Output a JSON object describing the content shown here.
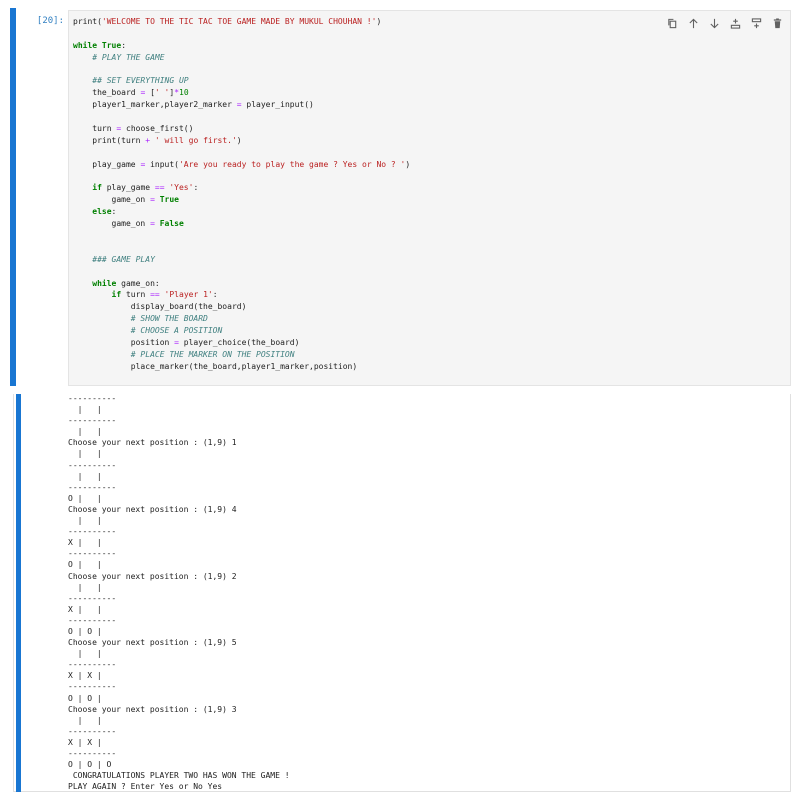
{
  "cell": {
    "prompt": "[20]:",
    "toolbar": [
      {
        "name": "duplicate-icon"
      },
      {
        "name": "move-up-icon"
      },
      {
        "name": "move-down-icon"
      },
      {
        "name": "insert-below-icon"
      },
      {
        "name": "insert-above-icon"
      },
      {
        "name": "delete-icon"
      }
    ],
    "code_lines": [
      [
        {
          "t": "print(",
          "c": ""
        },
        {
          "t": "'WELCOME TO THE TIC TAC TOE GAME MADE BY MUKUL CHOUHAN !'",
          "c": "str"
        },
        {
          "t": ")",
          "c": ""
        }
      ],
      [
        {
          "t": "",
          "c": ""
        }
      ],
      [
        {
          "t": "while",
          "c": "kw"
        },
        {
          "t": " ",
          "c": ""
        },
        {
          "t": "True",
          "c": "kw"
        },
        {
          "t": ":",
          "c": ""
        }
      ],
      [
        {
          "t": "    ",
          "c": ""
        },
        {
          "t": "# PLAY THE GAME",
          "c": "cm"
        }
      ],
      [
        {
          "t": "",
          "c": ""
        }
      ],
      [
        {
          "t": "    ",
          "c": ""
        },
        {
          "t": "## SET EVERYTHING UP",
          "c": "cm"
        }
      ],
      [
        {
          "t": "    the_board ",
          "c": ""
        },
        {
          "t": "=",
          "c": "op"
        },
        {
          "t": " [",
          "c": ""
        },
        {
          "t": "' '",
          "c": "str"
        },
        {
          "t": "]",
          "c": ""
        },
        {
          "t": "*",
          "c": "op"
        },
        {
          "t": "10",
          "c": "num"
        }
      ],
      [
        {
          "t": "    player1_marker,player2_marker ",
          "c": ""
        },
        {
          "t": "=",
          "c": "op"
        },
        {
          "t": " player_input()",
          "c": ""
        }
      ],
      [
        {
          "t": "",
          "c": ""
        }
      ],
      [
        {
          "t": "    turn ",
          "c": ""
        },
        {
          "t": "=",
          "c": "op"
        },
        {
          "t": " choose_first()",
          "c": ""
        }
      ],
      [
        {
          "t": "    print(turn ",
          "c": ""
        },
        {
          "t": "+",
          "c": "op"
        },
        {
          "t": " ",
          "c": ""
        },
        {
          "t": "' will go first.'",
          "c": "str"
        },
        {
          "t": ")",
          "c": ""
        }
      ],
      [
        {
          "t": "",
          "c": ""
        }
      ],
      [
        {
          "t": "    play_game ",
          "c": ""
        },
        {
          "t": "=",
          "c": "op"
        },
        {
          "t": " input(",
          "c": ""
        },
        {
          "t": "'Are you ready to play the game ? Yes or No ? '",
          "c": "str"
        },
        {
          "t": ")",
          "c": ""
        }
      ],
      [
        {
          "t": "",
          "c": ""
        }
      ],
      [
        {
          "t": "    ",
          "c": ""
        },
        {
          "t": "if",
          "c": "kw"
        },
        {
          "t": " play_game ",
          "c": ""
        },
        {
          "t": "==",
          "c": "op"
        },
        {
          "t": " ",
          "c": ""
        },
        {
          "t": "'Yes'",
          "c": "str"
        },
        {
          "t": ":",
          "c": ""
        }
      ],
      [
        {
          "t": "        game_on ",
          "c": ""
        },
        {
          "t": "=",
          "c": "op"
        },
        {
          "t": " ",
          "c": ""
        },
        {
          "t": "True",
          "c": "kw"
        }
      ],
      [
        {
          "t": "    ",
          "c": ""
        },
        {
          "t": "else",
          "c": "kw"
        },
        {
          "t": ":",
          "c": ""
        }
      ],
      [
        {
          "t": "        game_on ",
          "c": ""
        },
        {
          "t": "=",
          "c": "op"
        },
        {
          "t": " ",
          "c": ""
        },
        {
          "t": "False",
          "c": "kw"
        }
      ],
      [
        {
          "t": "",
          "c": ""
        }
      ],
      [
        {
          "t": "",
          "c": ""
        }
      ],
      [
        {
          "t": "    ",
          "c": ""
        },
        {
          "t": "### GAME PLAY",
          "c": "cm"
        }
      ],
      [
        {
          "t": "",
          "c": ""
        }
      ],
      [
        {
          "t": "    ",
          "c": ""
        },
        {
          "t": "while",
          "c": "kw"
        },
        {
          "t": " game_on:",
          "c": ""
        }
      ],
      [
        {
          "t": "        ",
          "c": ""
        },
        {
          "t": "if",
          "c": "kw"
        },
        {
          "t": " turn ",
          "c": ""
        },
        {
          "t": "==",
          "c": "op"
        },
        {
          "t": " ",
          "c": ""
        },
        {
          "t": "'Player 1'",
          "c": "str"
        },
        {
          "t": ":",
          "c": ""
        }
      ],
      [
        {
          "t": "            display_board(the_board)",
          "c": ""
        }
      ],
      [
        {
          "t": "            ",
          "c": ""
        },
        {
          "t": "# SHOW THE BOARD",
          "c": "cm"
        }
      ],
      [
        {
          "t": "            ",
          "c": ""
        },
        {
          "t": "# CHOOSE A POSITION",
          "c": "cm"
        }
      ],
      [
        {
          "t": "            position ",
          "c": ""
        },
        {
          "t": "=",
          "c": "op"
        },
        {
          "t": " player_choice(the_board)",
          "c": ""
        }
      ],
      [
        {
          "t": "            ",
          "c": ""
        },
        {
          "t": "# PLACE THE MARKER ON THE POSITION",
          "c": "cm"
        }
      ],
      [
        {
          "t": "            place_marker(the_board,player1_marker,position)",
          "c": ""
        }
      ]
    ]
  },
  "output": {
    "lines": [
      "----------",
      "  |   |",
      "----------",
      "  |   |",
      "Choose your next position : (1,9) 1",
      "  |   |",
      "----------",
      "  |   |",
      "----------",
      "O |   |",
      "Choose your next position : (1,9) 4",
      "  |   |",
      "----------",
      "X |   |",
      "----------",
      "O |   |",
      "Choose your next position : (1,9) 2",
      "  |   |",
      "----------",
      "X |   |",
      "----------",
      "O | O |",
      "Choose your next position : (1,9) 5",
      "  |   |",
      "----------",
      "X | X |",
      "----------",
      "O | O |",
      "Choose your next position : (1,9) 3",
      "  |   |",
      "----------",
      "X | X |",
      "----------",
      "O | O | O",
      " CONGRATULATIONS PLAYER TWO HAS WON THE GAME !",
      "PLAY AGAIN ? Enter Yes or No Yes"
    ]
  },
  "colors": {
    "accent": "#1976d2",
    "prompt": "#307fc1",
    "keyword": "#008000",
    "string": "#ba2121",
    "comment": "#408080",
    "operator": "#aa22ff",
    "editor_bg": "#f5f5f5"
  }
}
